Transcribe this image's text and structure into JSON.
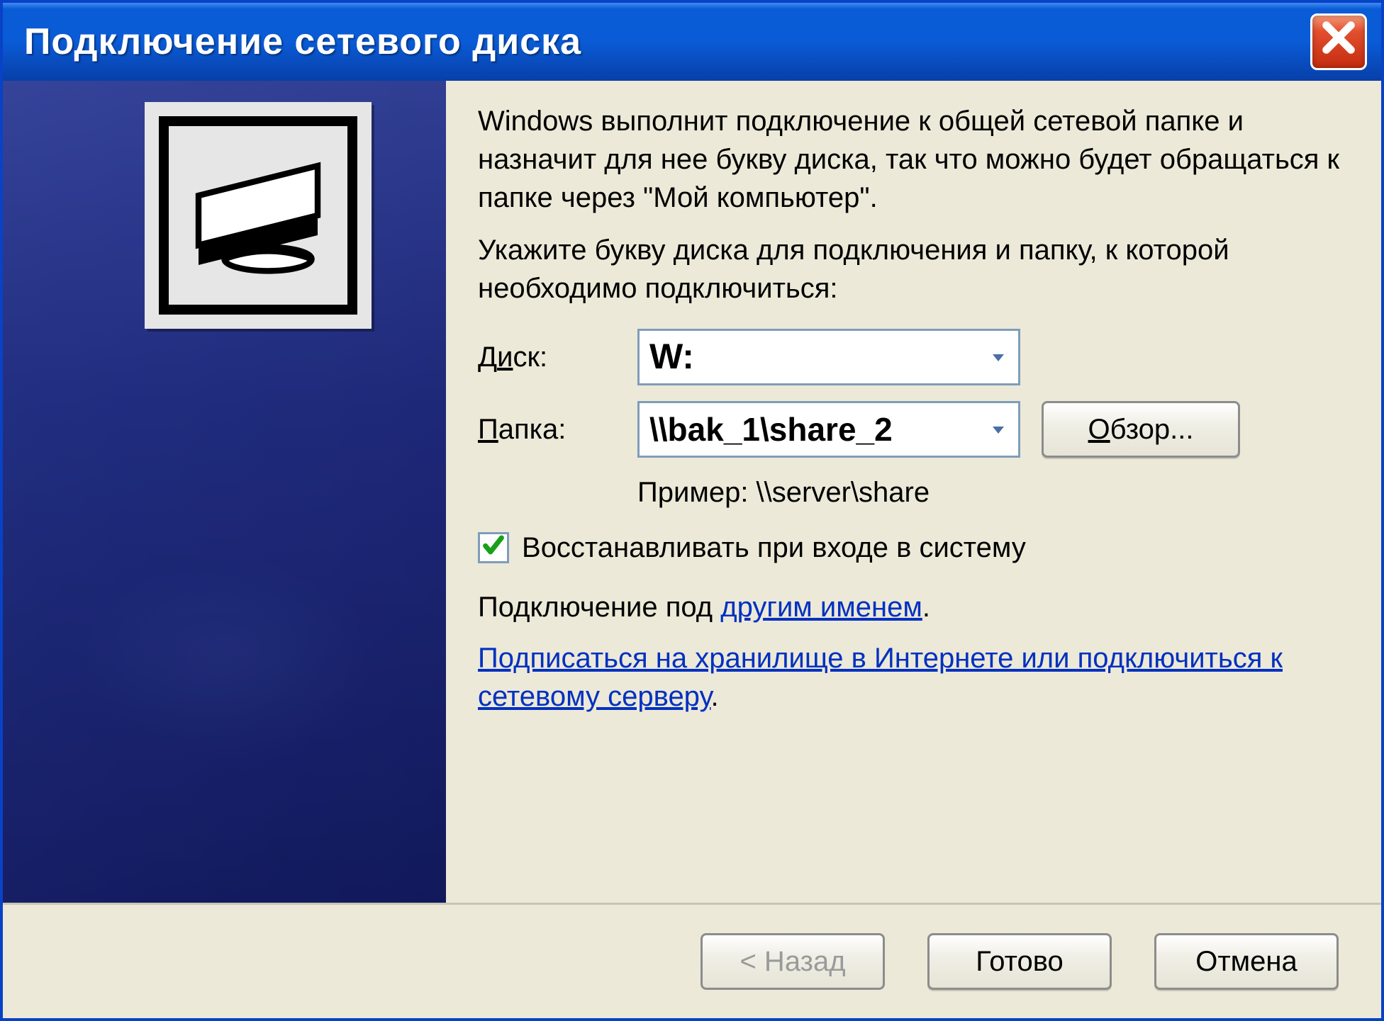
{
  "title": "Подключение сетевого диска",
  "description1": "Windows выполнит подключение к общей сетевой папке и назначит для нее букву диска, так что можно будет обращаться к папке через \"Мой компьютер\".",
  "description2": "Укажите букву диска для подключения и папку, к которой необходимо подключиться:",
  "form": {
    "drive_label_pre": "Д",
    "drive_label_accel": "и",
    "drive_label_post": "ск:",
    "drive_value": "W:",
    "folder_label_accel": "П",
    "folder_label_post": "апка:",
    "folder_value": "\\\\bak_1\\share_2",
    "browse_label_accel": "О",
    "browse_label_post": "бзор...",
    "example_label": "Пример: \\\\server\\share",
    "reconnect_accel": "В",
    "reconnect_post": "осстанавливать при входе в систему",
    "reconnect_checked": true
  },
  "links": {
    "connect_as_pre": "Подключение под ",
    "connect_as_link": "другим именем",
    "connect_as_post": ".",
    "signup_link": "Подписаться на хранилище в Интернете или подключиться к сетевому серверу",
    "signup_post": "."
  },
  "buttons": {
    "back": "< Назад",
    "finish": "Готово",
    "cancel": "Отмена"
  }
}
